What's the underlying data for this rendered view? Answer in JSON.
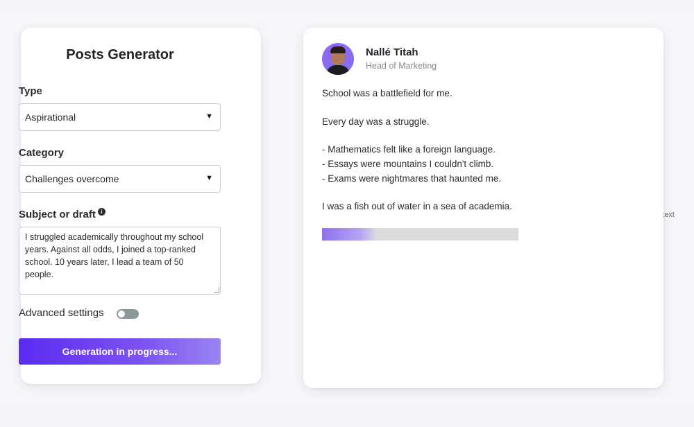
{
  "generator": {
    "title": "Posts Generator",
    "type_label": "Type",
    "type_value": "Aspirational",
    "category_label": "Category",
    "category_value": "Challenges overcome",
    "subject_label": "Subject or draft",
    "delete_text": "Delete text",
    "draft_text": "I struggled academically throughout my school years. Against all odds, I joined a top-ranked school. 10 years later, I lead a team of 50 people.",
    "advanced_label": "Advanced settings",
    "advanced_enabled": false,
    "button_label": "Generation in progress...",
    "icons": [
      "info-icon",
      "trash-icon",
      "dropdown-caret-icon"
    ]
  },
  "post": {
    "author_name": "Nallé Titah",
    "author_role": "Head of Marketing",
    "lines": [
      "School was a battlefield for me.",
      "Every day was a struggle.",
      "- Mathematics felt like a foreign language.",
      "- Essays were mountains I couldn't climb.",
      "- Exams were nightmares that haunted me.",
      "I was a fish out of water in a sea of academia."
    ],
    "progress_fraction": 0.28
  },
  "colors": {
    "accent": "#5b2cf0",
    "accent_light": "#9a83f2",
    "background": "#f4f4fa",
    "toggle_off": "#8d989b"
  }
}
